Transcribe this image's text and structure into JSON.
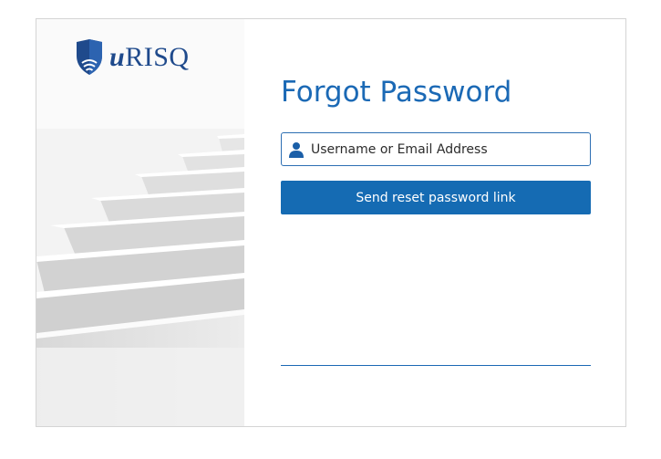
{
  "brand": {
    "name_prefix": "u",
    "name_suffix": "RISQ",
    "color": "#1f4a8c"
  },
  "form": {
    "title": "Forgot Password",
    "input": {
      "placeholder": "Username or Email Address",
      "value": "",
      "icon": "user-icon"
    },
    "submit_label": "Send reset password link"
  },
  "colors": {
    "accent": "#1b69b5",
    "button_bg": "#156bb3",
    "border": "#d4d4d4"
  }
}
